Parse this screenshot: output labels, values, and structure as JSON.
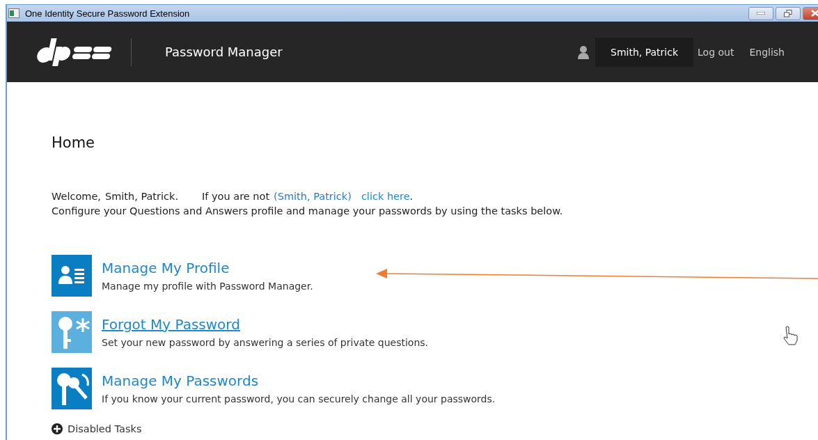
{
  "window": {
    "title": "One Identity Secure Password Extension"
  },
  "header": {
    "app_name": "Password Manager",
    "user": "Smith, Patrick",
    "logout": "Log out",
    "language": "English"
  },
  "page": {
    "title": "Home"
  },
  "welcome": {
    "greeting": "Welcome,",
    "name": "Smith, Patrick.",
    "not_prefix": "If you are not",
    "not_name": "(Smith, Patrick)",
    "link": "click here",
    "link_suffix": ".",
    "instructions": "Configure your Questions and Answers profile and manage your passwords by using the tasks below."
  },
  "tasks": [
    {
      "kind": "profile",
      "title": "Manage My Profile",
      "description": "Manage my profile with Password Manager.",
      "hovered": false
    },
    {
      "kind": "forgot",
      "title": "Forgot My Password",
      "description": "Set your new password by answering a series of private questions.",
      "hovered": true
    },
    {
      "kind": "manage",
      "title": "Manage My Passwords",
      "description": "If you know your current password, you can securely change all your passwords.",
      "hovered": false
    }
  ],
  "disabled_tasks": {
    "label": "Disabled Tasks",
    "expanded": false
  }
}
